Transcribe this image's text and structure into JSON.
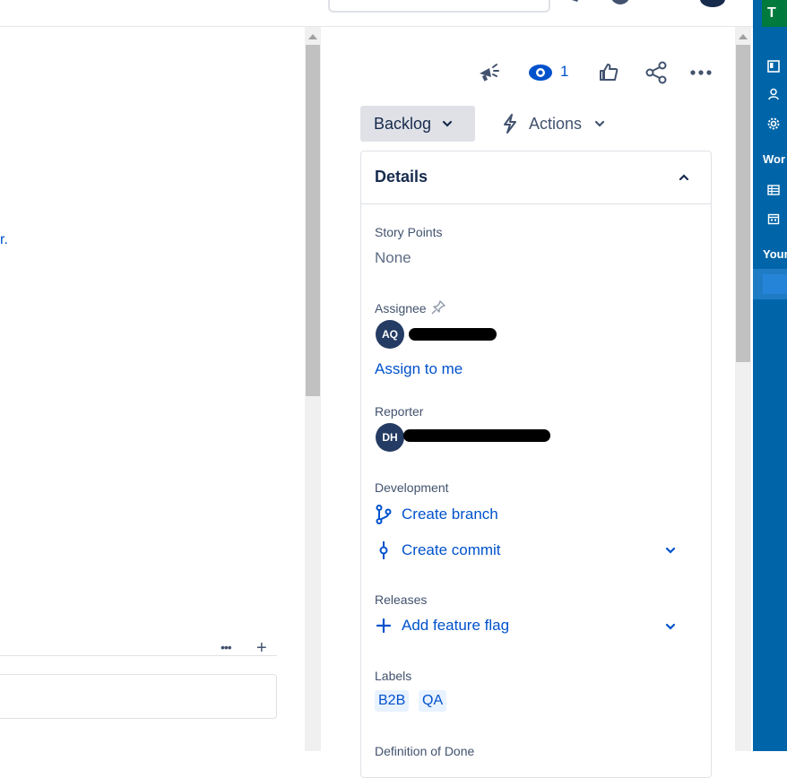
{
  "left": {
    "snippet": "r.",
    "more_label": "•••",
    "add_label": "+"
  },
  "detail": {
    "watch_count": "1",
    "status_label": "Backlog",
    "actions_label": "Actions",
    "details_title": "Details",
    "story_points": {
      "label": "Story Points",
      "value": "None"
    },
    "assignee": {
      "label": "Assignee",
      "initials": "AQ",
      "assign_link": "Assign to me"
    },
    "reporter": {
      "label": "Reporter",
      "initials": "DH"
    },
    "development": {
      "label": "Development",
      "create_branch": "Create branch",
      "create_commit": "Create commit"
    },
    "releases": {
      "label": "Releases",
      "add_flag": "Add feature flag"
    },
    "labels": {
      "label": "Labels",
      "items": [
        "B2B",
        "QA"
      ]
    },
    "dod": {
      "label": "Definition of Done"
    }
  },
  "sidebar": {
    "badge": "T",
    "section1": "Wor",
    "section2": "Your"
  },
  "colors": {
    "link": "#0052cc",
    "sidebar": "#0065a8",
    "badge": "#007a3d"
  }
}
